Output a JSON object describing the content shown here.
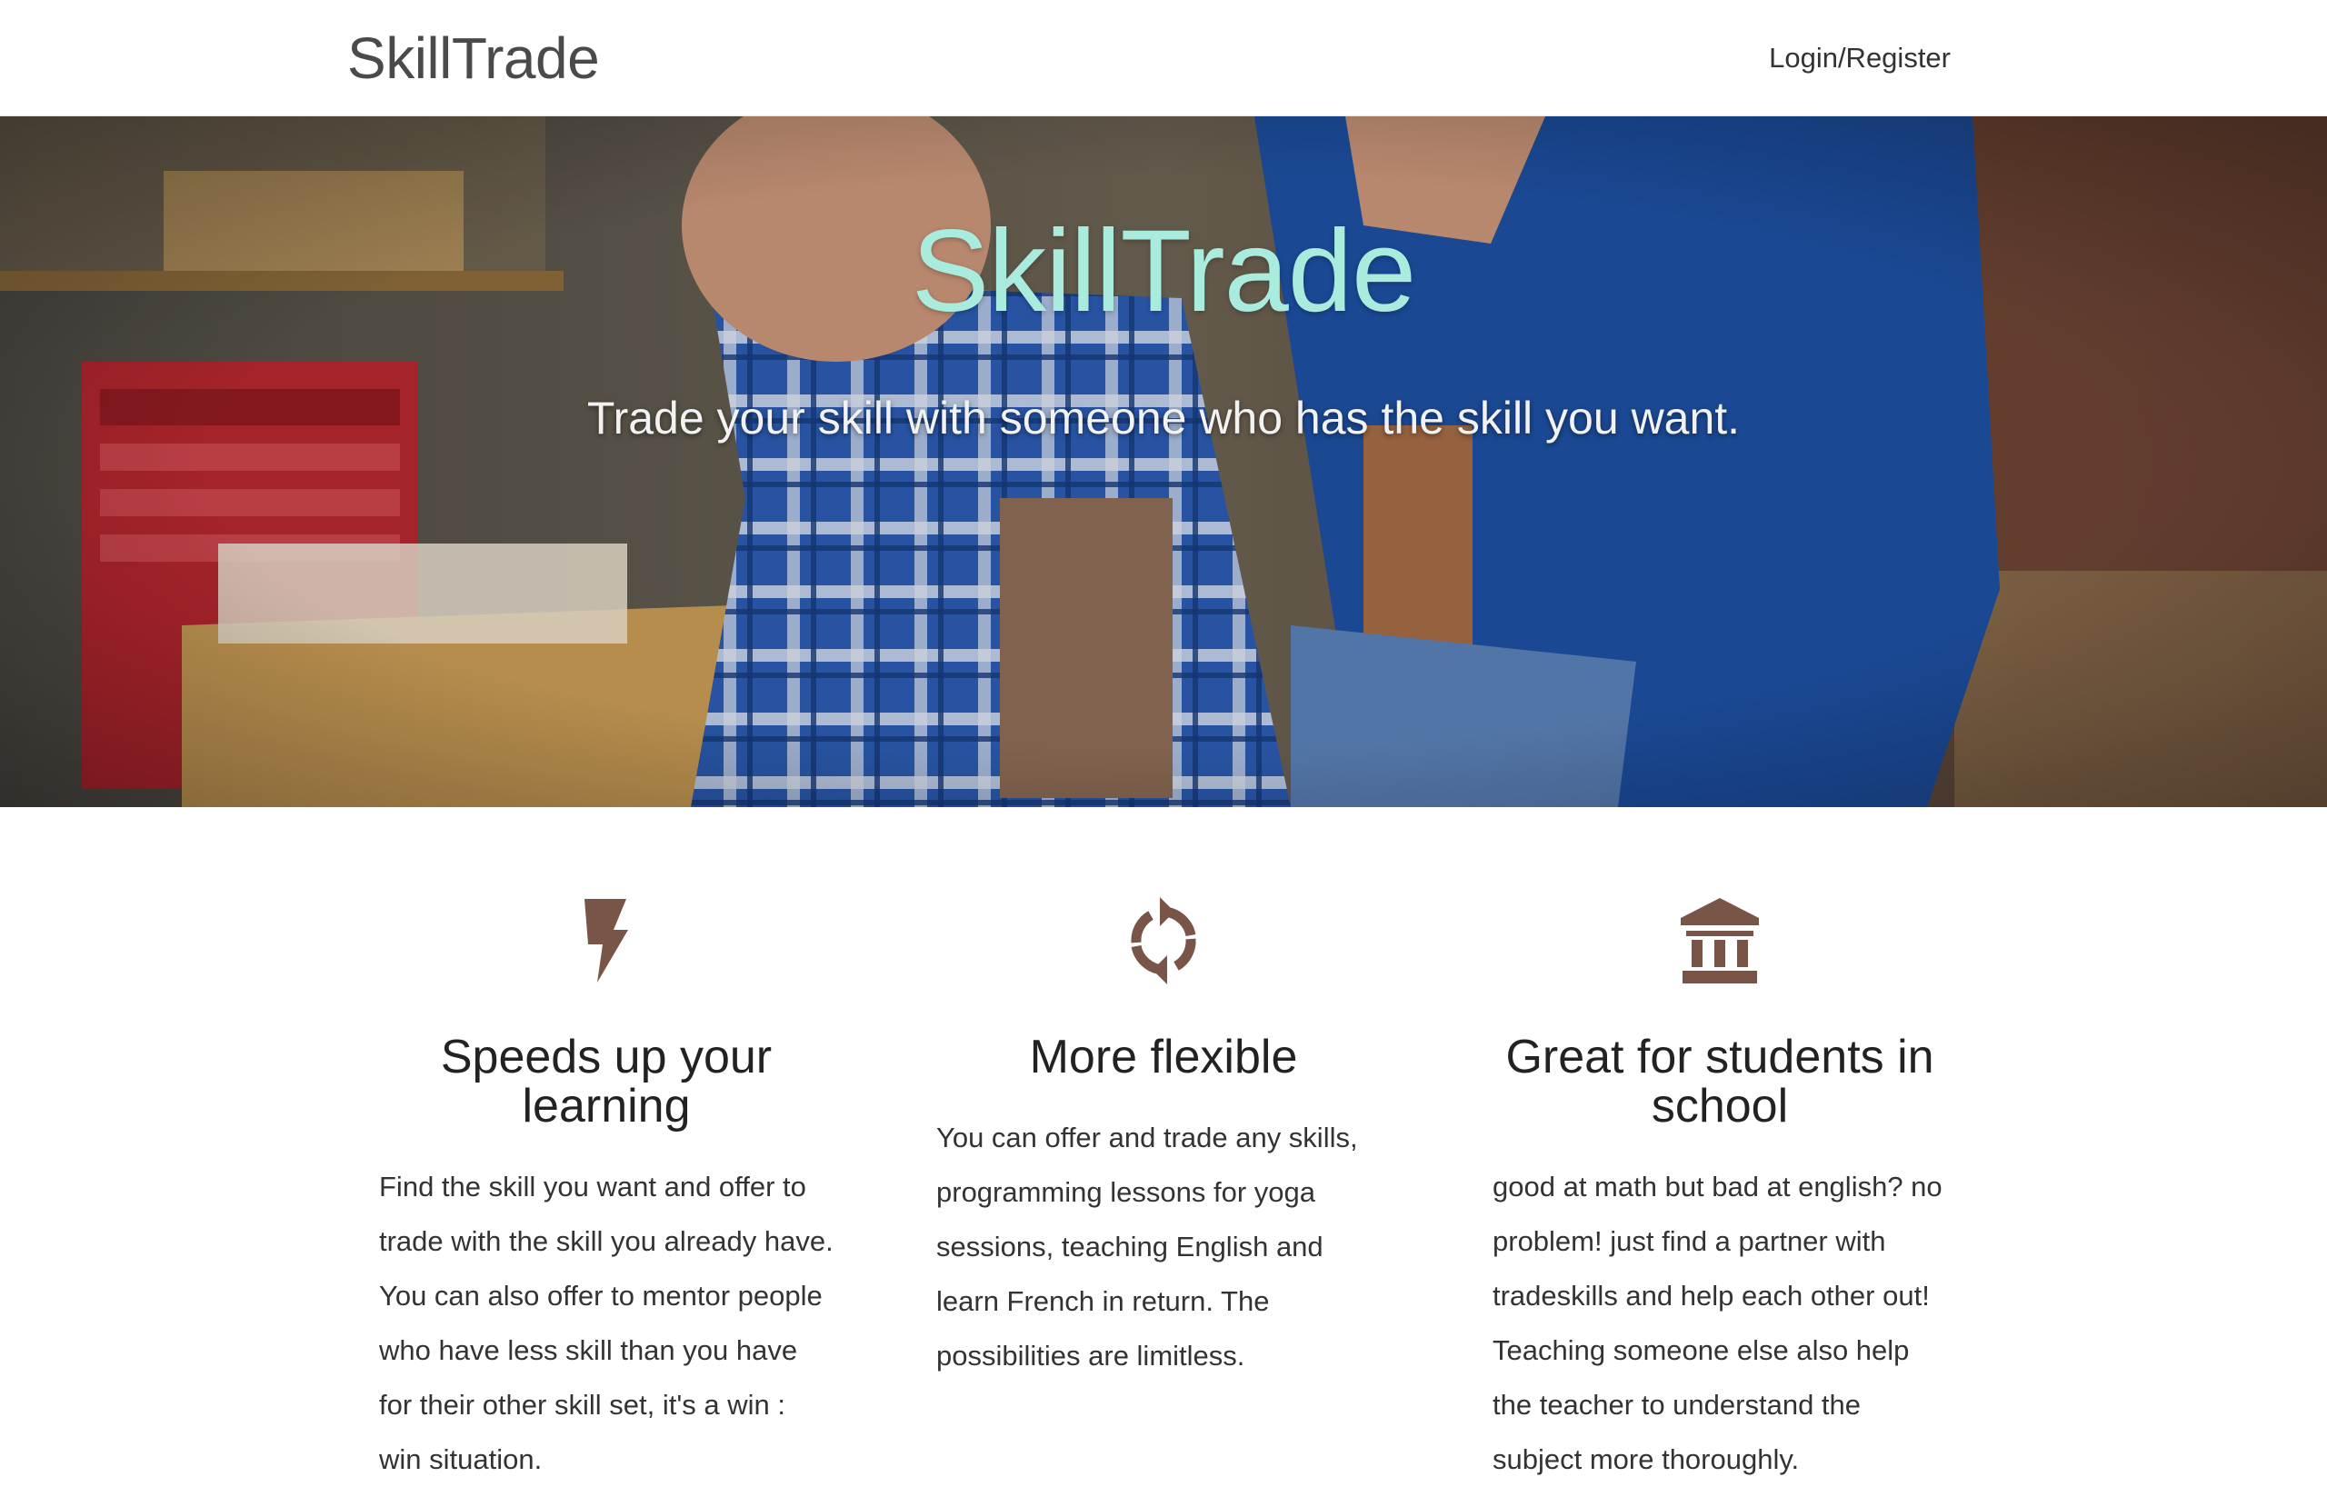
{
  "nav": {
    "brand": "SkillTrade",
    "login_label": "Login/Register"
  },
  "hero": {
    "title": "SkillTrade",
    "subtitle": "Trade your skill with someone who has the skill you want.",
    "title_color": "#a9ecdd"
  },
  "features": [
    {
      "icon": "lightning-bolt-icon",
      "title": "Speeds up your learning",
      "body": "Find the skill you want and offer to trade with the skill you already have. You can also offer to mentor people who have less skill than you have for their other skill set, it's a win : win situation."
    },
    {
      "icon": "refresh-cycle-icon",
      "title": "More flexible",
      "body": "You can offer and trade any skills, programming lessons for yoga sessions, teaching English and learn French in return. The possibilities are limitless."
    },
    {
      "icon": "institution-icon",
      "title": "Great for students in school",
      "body": "good at math but bad at english? no problem! just find a partner with tradeskills and help each other out! Teaching someone else also help the teacher to understand the subject more thoroughly."
    }
  ],
  "colors": {
    "icon_brown": "#795548",
    "text_dark": "#222222"
  }
}
